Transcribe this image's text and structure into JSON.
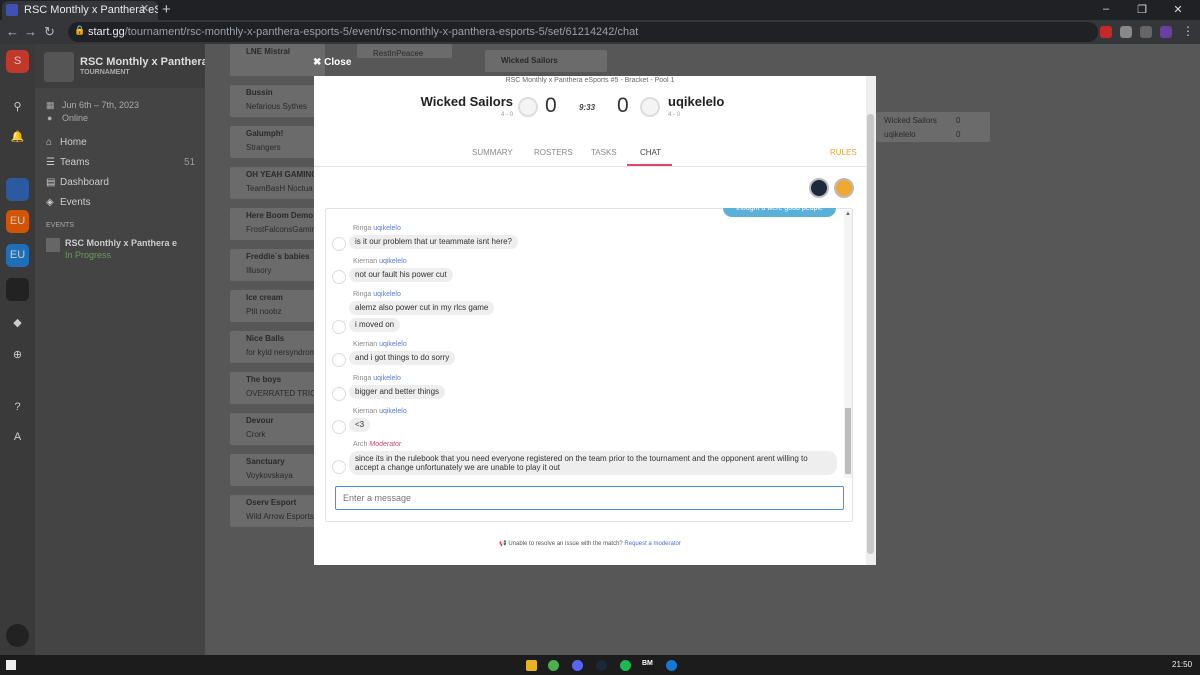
{
  "browser": {
    "tab_title": "RSC Monthly x Panthera eSports",
    "tab_close": "✕",
    "new_tab": "+",
    "url_host": "start.gg",
    "url_path": "/tournament/rsc-monthly-x-panthera-esports-5/event/rsc-monthly-x-panthera-esports-5/set/61214242/chat",
    "window_buttons": [
      "–",
      "❐",
      "✕"
    ]
  },
  "sidebar": {
    "tournament_title": "RSC Monthly x Panthera eS",
    "tournament_sub": "TOURNAMENT",
    "dates": "Jun 6th – 7th, 2023",
    "location": "Online",
    "nav": [
      {
        "label": "Home"
      },
      {
        "label": "Teams",
        "count": "51"
      },
      {
        "label": "Dashboard"
      },
      {
        "label": "Events"
      }
    ],
    "events_header": "EVENTS",
    "event_name": "RSC Monthly x Panthera e",
    "event_status": "In Progress",
    "rail_labels": [
      "EU",
      "EU"
    ]
  },
  "bracket_bg": {
    "col1": [
      {
        "a": "LNE Mistral",
        "b": ""
      },
      {
        "a": "Bussin",
        "b": "Nefarious Sythes"
      },
      {
        "a": "Galumph!",
        "b": "Strangers"
      },
      {
        "a": "OH YEAH GAMING",
        "b": "TeamBasH Noctua"
      },
      {
        "a": "Here Boom Demo",
        "b": "FrostFalconsGaming"
      },
      {
        "a": "Freddie`s babies",
        "b": "Illusory"
      },
      {
        "a": "Ice cream",
        "b": "Ptit noobz"
      },
      {
        "a": "Nice Balls",
        "b": "for kyld nersyndrome"
      },
      {
        "a": "The boys",
        "b": "OVERRATED TRIO"
      },
      {
        "a": "Devour",
        "b": "Crork"
      },
      {
        "a": "Sanctuary",
        "b": "Voykovskaya"
      },
      {
        "a": "Oserv Esport",
        "b": "Wild Arrow Esports"
      }
    ],
    "top_mid": "RestInPeacee",
    "top_right": "Wicked Sailors",
    "right_match": {
      "a": "Wicked Sailors",
      "b": "uqikelelo",
      "sa": "0",
      "sb": "0"
    }
  },
  "modal": {
    "close_label": "Close",
    "pool": "RSC Monthly x Panthera eSports #5 - Bracket - Pool 1",
    "team1": {
      "name": "Wicked Sailors",
      "record": "4 - 0",
      "score": "0"
    },
    "team2": {
      "name": "uqikelelo",
      "record": "4 - 0",
      "score": "0"
    },
    "timer": "9:33",
    "tabs": {
      "summary": "SUMMARY",
      "rosters": "ROSTERS",
      "tasks": "TASKS",
      "chat": "CHAT",
      "rules": "RULES"
    },
    "partial_message": "thought u were good people",
    "messages": [
      {
        "sender": "Ringa",
        "team": "uqikelelo",
        "bubbles": [
          "is it our problem that ur teammate isnt here?"
        ]
      },
      {
        "sender": "Kiernan",
        "team": "uqikelelo",
        "bubbles": [
          "not our fault his power cut"
        ]
      },
      {
        "sender": "Ringa",
        "team": "uqikelelo",
        "bubbles": [
          "alemz also power cut in my rlcs game",
          "i moved on"
        ]
      },
      {
        "sender": "Kiernan",
        "team": "uqikelelo",
        "bubbles": [
          "and i got things to do sorry"
        ]
      },
      {
        "sender": "Ringa",
        "team": "uqikelelo",
        "bubbles": [
          "bigger and better things"
        ]
      },
      {
        "sender": "Kiernan",
        "team": "uqikelelo",
        "bubbles": [
          "<3"
        ]
      },
      {
        "sender": "Arch",
        "role": "Moderator",
        "bubbles": [
          "since its in the rulebook that you need everyone registered on the team prior to the tournament and the opponent arent willing to accept a change unfortunately we are unable to play it out"
        ]
      }
    ],
    "input_placeholder": "Enter a message",
    "issue_text": "Unable to resolve an issue with the match?",
    "issue_link": "Request a moderator"
  },
  "taskbar": {
    "time": "21:50",
    "bm_label": "BM"
  }
}
